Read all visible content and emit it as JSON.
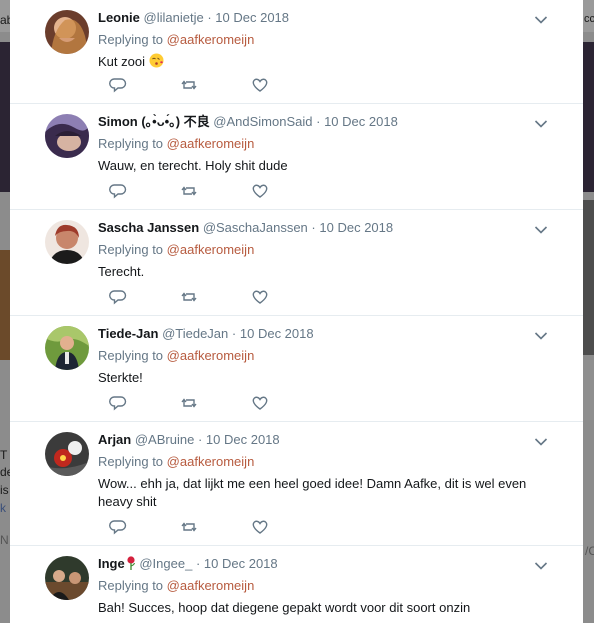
{
  "colors": {
    "accent_link": "#b75b3f",
    "muted_text": "#657786",
    "primary_text": "#14171a",
    "divider": "#e6ecf0",
    "backdrop": "#8c8c8c"
  },
  "tweets": [
    {
      "name": "Leonie",
      "handle": "@lilanietje",
      "time": "10 Dec 2018",
      "replying_prefix": "Replying to",
      "replying_to": "@aafkeromeijn",
      "text": "Kut zooi",
      "emoji": "kissing-face-emoji",
      "avatar": "avatar-photo"
    },
    {
      "name": "Simon (｡•̀ᴗ•́｡) 不良",
      "handle": "@AndSimonSaid",
      "time": "10 Dec 2018",
      "replying_prefix": "Replying to",
      "replying_to": "@aafkeromeijn",
      "text": "Wauw, en terecht. Holy shit dude",
      "avatar": "avatar-photo"
    },
    {
      "name": "Sascha Janssen",
      "handle": "@SaschaJanssen",
      "time": "10 Dec 2018",
      "replying_prefix": "Replying to",
      "replying_to": "@aafkeromeijn",
      "text": "Terecht.",
      "avatar": "avatar-photo"
    },
    {
      "name": "Tiede-Jan",
      "handle": "@TiedeJan",
      "time": "10 Dec 2018",
      "replying_prefix": "Replying to",
      "replying_to": "@aafkeromeijn",
      "text": "Sterkte!",
      "avatar": "avatar-photo"
    },
    {
      "name": "Arjan",
      "handle": "@ABruine",
      "time": "10 Dec 2018",
      "replying_prefix": "Replying to",
      "replying_to": "@aafkeromeijn",
      "text": "Wow... ehh ja, dat lijkt me een heel goed idee! Damn Aafke, dit is wel even heavy shit",
      "avatar": "avatar-photo"
    },
    {
      "name": "Inge",
      "handle": "@Ingee_",
      "time": "10 Dec 2018",
      "replying_prefix": "Replying to",
      "replying_to": "@aafkeromeijn",
      "text": "Bah! Succes, hoop dat diegene gepakt wordt voor dit soort onzin",
      "emoji": "rose-emoji",
      "avatar": "avatar-photo"
    }
  ],
  "separator": "·",
  "icons": {
    "reply": "reply-icon",
    "retweet": "retweet-icon",
    "like": "heart-icon",
    "menu": "chevron-down-icon"
  },
  "background_fragments": {
    "top_left": "ab",
    "top_right": "cc",
    "left_1": "T",
    "left_2": "de",
    "left_3": "is",
    "left_4": "k",
    "left_5": "N",
    "right_1": "/C"
  }
}
